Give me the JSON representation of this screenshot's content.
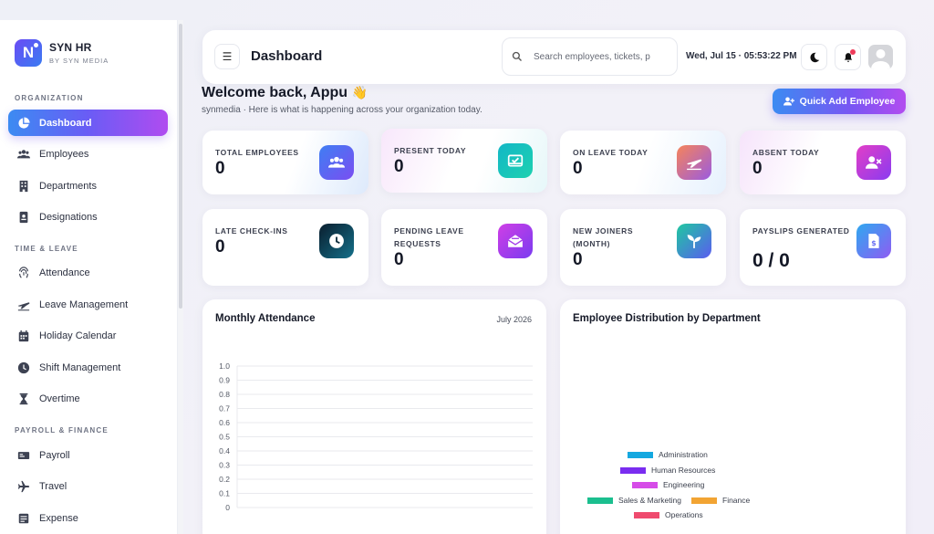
{
  "brand": {
    "name": "SYN HR",
    "sub": "BY SYN MEDIA",
    "logo_letter": "N"
  },
  "sidebar": {
    "sections": [
      {
        "title": "ORGANIZATION",
        "items": [
          {
            "label": "Dashboard",
            "icon": "pie-chart-icon",
            "active": true
          },
          {
            "label": "Employees",
            "icon": "users-icon"
          },
          {
            "label": "Departments",
            "icon": "building-icon"
          },
          {
            "label": "Designations",
            "icon": "id-badge-icon"
          }
        ]
      },
      {
        "title": "TIME & LEAVE",
        "items": [
          {
            "label": "Attendance",
            "icon": "fingerprint-icon"
          },
          {
            "label": "Leave Management",
            "icon": "plane-icon"
          },
          {
            "label": "Holiday Calendar",
            "icon": "calendar-icon"
          },
          {
            "label": "Shift Management",
            "icon": "clock-icon"
          },
          {
            "label": "Overtime",
            "icon": "hourglass-icon"
          }
        ]
      },
      {
        "title": "PAYROLL & FINANCE",
        "items": [
          {
            "label": "Payroll",
            "icon": "money-icon"
          },
          {
            "label": "Travel",
            "icon": "plane-icon"
          },
          {
            "label": "Expense",
            "icon": "receipt-icon"
          }
        ]
      }
    ]
  },
  "header": {
    "menu_icon": "hamburger-icon",
    "title": "Dashboard",
    "search_placeholder": "Search employees, tickets, p",
    "datetime": "Wed, Jul 15 · 05:53:22 PM"
  },
  "welcome": {
    "title": "Welcome back, Appu",
    "emoji": "👋",
    "subtitle": "synmedia · Here is what is happening across your organization today.",
    "quick_add_label": "Quick Add Employee"
  },
  "stats": [
    {
      "label": "TOTAL EMPLOYEES",
      "value": "0",
      "icon": "users-icon",
      "color": "#5b5cf0"
    },
    {
      "label": "PRESENT TODAY",
      "value": "0",
      "icon": "inbox-check-icon",
      "color": "#15b8c9"
    },
    {
      "label": "ON LEAVE TODAY",
      "value": "0",
      "icon": "plane-icon",
      "color": "#f08a5d"
    },
    {
      "label": "ABSENT TODAY",
      "value": "0",
      "icon": "user-x-icon",
      "color": "#d93ad0"
    },
    {
      "label": "LATE CHECK-INS",
      "value": "0",
      "icon": "clock-icon",
      "color": "#0c4f63"
    },
    {
      "label": "PENDING LEAVE REQUESTS",
      "value": "0",
      "icon": "mail-open-icon",
      "color": "#b240ef"
    },
    {
      "label": "NEW JOINERS (MONTH)",
      "value": "0",
      "icon": "sprout-icon",
      "color": "#1fc3a0"
    },
    {
      "label": "PAYSLIPS GENERATED",
      "value": "0 / 0",
      "icon": "file-dollar-icon",
      "color": "#5f8cf5"
    }
  ],
  "attendance": {
    "title": "Monthly Attendance",
    "period": "July 2026"
  },
  "distribution": {
    "title": "Employee Distribution by Department"
  },
  "chart_data": [
    {
      "type": "line",
      "title": "Monthly Attendance",
      "y_ticks": [
        "1.0",
        "0.9",
        "0.8",
        "0.7",
        "0.6",
        "0.5",
        "0.4",
        "0.3",
        "0.2",
        "0.1",
        "0"
      ],
      "ylim": [
        0,
        1
      ],
      "series": [],
      "grid": true
    },
    {
      "type": "pie",
      "title": "Employee Distribution by Department",
      "legend": [
        {
          "label": "Administration",
          "color": "#14a8e0"
        },
        {
          "label": "Human Resources",
          "color": "#7a2df0"
        },
        {
          "label": "Engineering",
          "color": "#d64ce8"
        },
        {
          "label": "Sales & Marketing",
          "color": "#1bbf8f"
        },
        {
          "label": "Finance",
          "color": "#f2a433"
        },
        {
          "label": "Operations",
          "color": "#ef4a6e"
        }
      ],
      "values": [],
      "legend_placement": "bottom"
    }
  ]
}
